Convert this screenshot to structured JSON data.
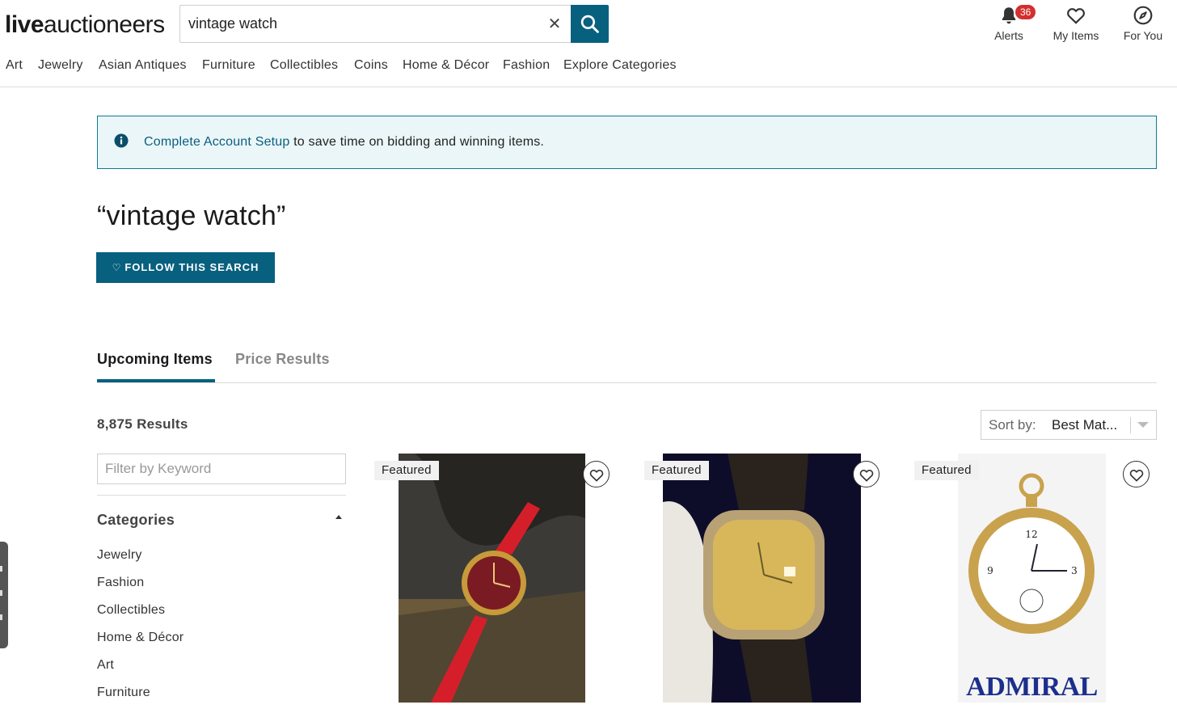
{
  "header": {
    "logo_bold": "live",
    "logo_rest": "auctioneers",
    "search_value": "vintage watch",
    "alerts_label": "Alerts",
    "alerts_count": "36",
    "my_items_label": "My Items",
    "for_you_label": "For You"
  },
  "nav": [
    "Art",
    "Jewelry",
    "Asian Antiques",
    "Furniture",
    "Collectibles",
    "Coins",
    "Home & Décor",
    "Fashion",
    "Explore Categories"
  ],
  "banner": {
    "link": "Complete Account Setup",
    "text": " to save time on bidding and winning items."
  },
  "page": {
    "title": "“vintage watch”",
    "follow_button": "FOLLOW THIS SEARCH"
  },
  "tabs": {
    "upcoming": "Upcoming Items",
    "price_results": "Price Results"
  },
  "results": {
    "count": "8,875 Results",
    "sort_label": "Sort by:",
    "sort_value": "Best Mat..."
  },
  "sidebar": {
    "filter_placeholder": "Filter by Keyword",
    "categories_heading": "Categories",
    "categories": [
      "Jewelry",
      "Fashion",
      "Collectibles",
      "Home & Décor",
      "Art",
      "Furniture"
    ]
  },
  "cards": [
    {
      "badge": "Featured"
    },
    {
      "badge": "Featured"
    },
    {
      "badge": "Featured",
      "image_text": "ADMIRAL"
    }
  ],
  "colors": {
    "brand": "#08607f",
    "banner_bg": "#ebf6f8",
    "badge_red": "#d32f2f"
  }
}
